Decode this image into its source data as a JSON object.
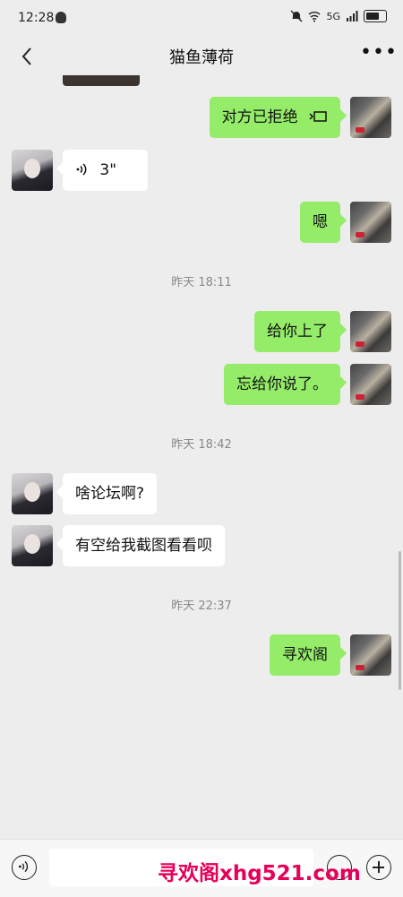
{
  "status": {
    "time": "12:28",
    "network": "5G"
  },
  "header": {
    "title": "猫鱼薄荷"
  },
  "messages": [
    {
      "text": "对方已拒绝"
    },
    {
      "text": "3\""
    },
    {
      "text": "嗯"
    },
    {
      "time": "昨天 18:11"
    },
    {
      "text": "给你上了"
    },
    {
      "text": "忘给你说了。"
    },
    {
      "time": "昨天 18:42"
    },
    {
      "text": "啥论坛啊?"
    },
    {
      "text": "有空给我截图看看呗"
    },
    {
      "time": "昨天 22:37"
    },
    {
      "text": "寻欢阁"
    }
  ],
  "watermark": "寻欢阁xhg521.com",
  "input": {
    "value": ""
  }
}
